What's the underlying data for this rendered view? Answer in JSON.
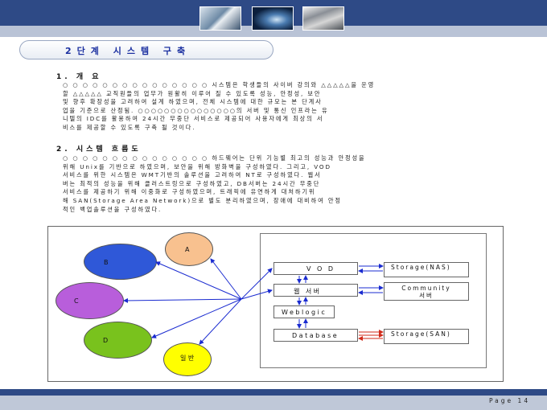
{
  "header": {
    "photos": [
      "office-photo",
      "network-graphic-photo",
      "people-photo"
    ]
  },
  "title": "2단계 시스템 구축",
  "section1": {
    "heading": "1. 개 요",
    "lines": [
      "○ ○ ○ ○ ○ ○ ○ ○ ○ ○ ○ ○ ○ ○ ○  시스템은 학생들의 사이버 강의와 △△△△△을 운영",
      "할 △△△△△ 교직원들의 업무가 원활히 이루어 질 수 있도록 성능, 안정성, 보안",
      "및 향후 확장성을 고려하여 설계 하였으며, 전체 시스템에 대한 규모는 본 단계사",
      "업을 기준으로 산정됨. ○○○○○○○○○○○○○○○의 서버 및 통신 인프라는 유",
      "니텔의 IDC를 활용하여 24시간 무중단 서비스로 제공되어 사용자에게 최상의 서",
      "비스를 제공할 수 있도록 구축 될 것이다."
    ]
  },
  "section2": {
    "heading": "2. 시스템 흐름도",
    "lines": [
      "○ ○ ○ ○ ○ ○ ○ ○ ○ ○ ○ ○ ○ ○ ○  하드웨어는 단위 기능별 최고의 성능과 안정성을",
      "위해 Unix를 기반으로 하였으며, 보안을 위해 방화벽을 구성하였다. 그리고, VOD",
      "서비스를 위한 시스템은 WMT기반의 솔루션을 고려하여 NT로 구성하였다. 웹서",
      "버는 최적의 성능을 위해 클러스트링으로 구성하였고, DB서버는 24시간 무중단",
      "서비스를 제공하기 위해 이중화로 구성하였으며, 트래픽에 유연하게 대처하기위",
      "해 SAN(Storage Area Network)으로 별도 분리하였으며, 장애에 대비하여 안정",
      "적인 백업솔루션을 구성하였다."
    ]
  },
  "diagram": {
    "users": [
      {
        "label": "A",
        "color": "#f8c18f"
      },
      {
        "label": "B",
        "color": "#2f58d8"
      },
      {
        "label": "C",
        "color": "#b85edb"
      },
      {
        "label": "D",
        "color": "#79c21d"
      },
      {
        "label": "일 반",
        "color": "#ffff00"
      }
    ],
    "servers": {
      "vod": "V O D",
      "web": "웹 서버",
      "weblogic": "Weblogic",
      "database": "Database"
    },
    "storage": {
      "nas": "Storage(NAS)",
      "community_line1": "Community",
      "community_line2": "서버",
      "san": "Storage(SAN)"
    },
    "colors": {
      "wire": "#1a2bd0",
      "san_link": "#d02a1a"
    }
  },
  "footer": {
    "page": "Page 14"
  }
}
